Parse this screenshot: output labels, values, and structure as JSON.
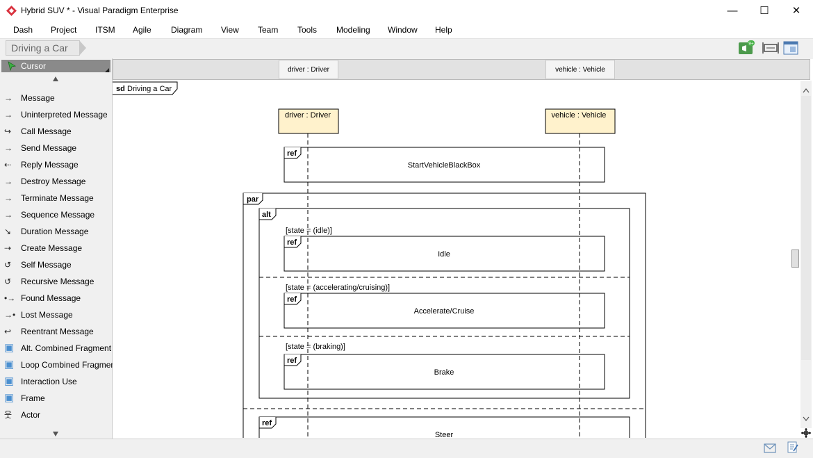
{
  "window": {
    "title": "Hybrid SUV * - Visual Paradigm Enterprise",
    "minimize": "—",
    "maximize": "☐",
    "close": "✕"
  },
  "menu": [
    "Dash",
    "Project",
    "ITSM",
    "Agile",
    "Diagram",
    "View",
    "Team",
    "Tools",
    "Modeling",
    "Window",
    "Help"
  ],
  "breadcrumb": "Driving a Car",
  "toolbar": {
    "notification_badge": "9+"
  },
  "palette": {
    "cursor": "Cursor",
    "items": [
      {
        "icon": "message-icon",
        "glyph": "→",
        "label": "Message"
      },
      {
        "icon": "uninterpreted-message-icon",
        "glyph": "→",
        "label": "Uninterpreted Message"
      },
      {
        "icon": "call-message-icon",
        "glyph": "↪",
        "label": "Call Message"
      },
      {
        "icon": "send-message-icon",
        "glyph": "→",
        "label": "Send Message"
      },
      {
        "icon": "reply-message-icon",
        "glyph": "⇠",
        "label": "Reply Message"
      },
      {
        "icon": "destroy-message-icon",
        "glyph": "→",
        "label": "Destroy Message"
      },
      {
        "icon": "terminate-message-icon",
        "glyph": "→",
        "label": "Terminate Message"
      },
      {
        "icon": "sequence-message-icon",
        "glyph": "→",
        "label": "Sequence Message"
      },
      {
        "icon": "duration-message-icon",
        "glyph": "↘",
        "label": "Duration Message"
      },
      {
        "icon": "create-message-icon",
        "glyph": "⇢",
        "label": "Create Message"
      },
      {
        "icon": "self-message-icon",
        "glyph": "↺",
        "label": "Self Message"
      },
      {
        "icon": "recursive-message-icon",
        "glyph": "↺",
        "label": "Recursive Message"
      },
      {
        "icon": "found-message-icon",
        "glyph": "•→",
        "label": "Found Message"
      },
      {
        "icon": "lost-message-icon",
        "glyph": "→•",
        "label": "Lost Message"
      },
      {
        "icon": "reentrant-message-icon",
        "glyph": "↩",
        "label": "Reentrant Message"
      },
      {
        "icon": "alt-combined-fragment-icon",
        "glyph": "▣",
        "label": "Alt. Combined Fragment"
      },
      {
        "icon": "loop-combined-fragment-icon",
        "glyph": "▣",
        "label": "Loop Combined Fragment"
      },
      {
        "icon": "interaction-use-icon",
        "glyph": "▣",
        "label": "Interaction Use"
      },
      {
        "icon": "frame-icon",
        "glyph": "▣",
        "label": "Frame"
      },
      {
        "icon": "actor-icon",
        "glyph": "웃",
        "label": "Actor"
      }
    ]
  },
  "diagram": {
    "frame_kw": "sd",
    "frame_name": "Driving a Car",
    "lifelines": [
      {
        "label": "driver : Driver"
      },
      {
        "label": "vehicle : Vehicle"
      }
    ],
    "ref_kw": "ref",
    "par_kw": "par",
    "alt_kw": "alt",
    "refs": {
      "start": "StartVehicleBlackBox",
      "idle": "Idle",
      "accelerate": "Accelerate/Cruise",
      "brake": "Brake",
      "steer": "Steer"
    },
    "guards": {
      "idle": "[state = (idle)]",
      "accelerate": "[state = (accelerating/cruising)]",
      "brake": "[state = (braking)]"
    }
  },
  "colors": {
    "lifeline_fill": "#fff2cc",
    "palette_bg": "#f0f0f0",
    "cursor_bg": "#8a8a8a"
  }
}
